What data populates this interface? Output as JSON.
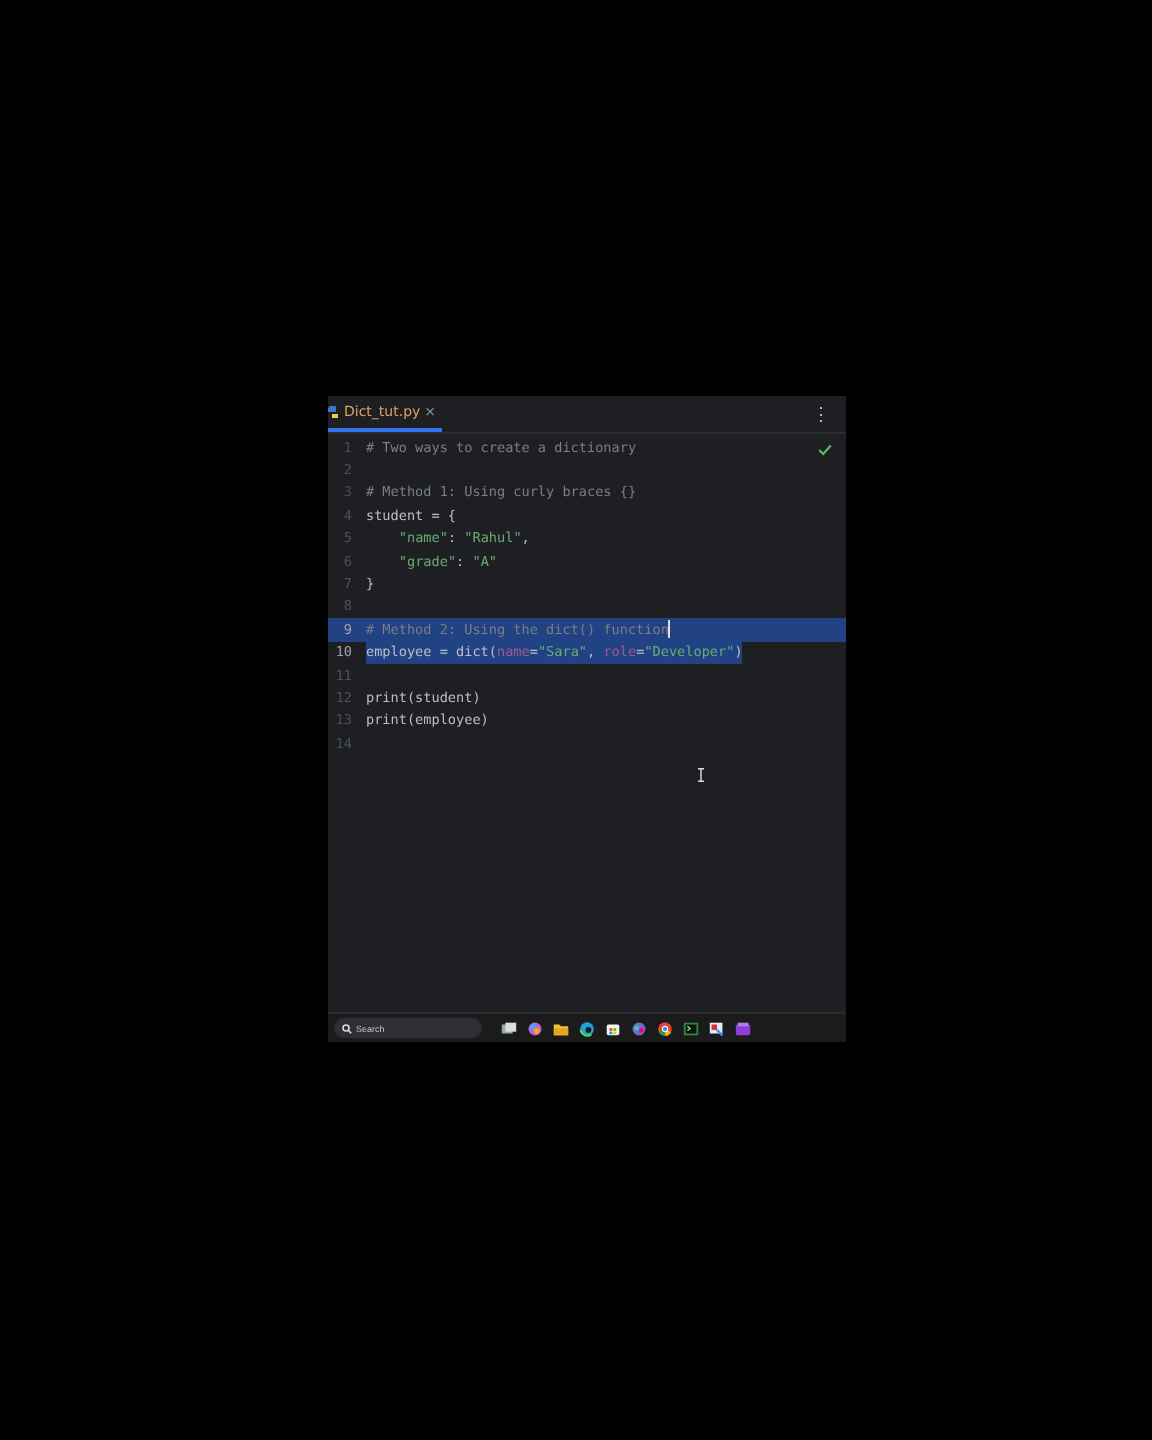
{
  "tab": {
    "label": "Dict_tut.py",
    "close": "×",
    "selected": true
  },
  "menu": "⋮",
  "lines": [
    {
      "number": "1",
      "selected": false,
      "caret": false,
      "tokens": [
        {
          "kind": "comment",
          "text": "# Two ways to create a dictionary"
        }
      ]
    },
    {
      "number": "2",
      "selected": false,
      "caret": false
    },
    {
      "number": "3",
      "selected": false,
      "caret": false,
      "tokens": [
        {
          "kind": "comment",
          "text": "# Method 1: Using curly braces {}"
        }
      ]
    },
    {
      "number": "4",
      "selected": false,
      "caret": false,
      "tokens": [
        {
          "kind": "plain",
          "text": "student = {"
        }
      ]
    },
    {
      "number": "5",
      "selected": false,
      "caret": false,
      "indented": true,
      "tokens": [
        {
          "kind": "string",
          "text": "\"name\""
        },
        {
          "kind": "plain",
          "text": ": "
        },
        {
          "kind": "string",
          "text": "\"Rahul\""
        },
        {
          "kind": "plain",
          "text": ","
        }
      ]
    },
    {
      "number": "6",
      "selected": false,
      "caret": false,
      "indented": true,
      "tokens": [
        {
          "kind": "string",
          "text": "\"grade\""
        },
        {
          "kind": "plain",
          "text": ": "
        },
        {
          "kind": "string",
          "text": "\"A\""
        }
      ]
    },
    {
      "number": "7",
      "selected": false,
      "caret": false,
      "tokens": [
        {
          "kind": "plain",
          "text": "}"
        }
      ]
    },
    {
      "number": "8",
      "selected": false,
      "caret": false
    },
    {
      "number": "9",
      "selected": true,
      "caret": true,
      "tokens": [
        {
          "kind": "comment",
          "text": "# Method 2: Using the dict() function"
        }
      ]
    },
    {
      "number": "10",
      "selected": true,
      "caret": false,
      "tokens": [
        {
          "kind": "plain",
          "text": "employee = dict("
        },
        {
          "kind": "param",
          "text": "name"
        },
        {
          "kind": "plain",
          "text": "="
        },
        {
          "kind": "string",
          "text": "\"Sara\""
        },
        {
          "kind": "plain",
          "text": ", "
        },
        {
          "kind": "param",
          "text": "role"
        },
        {
          "kind": "plain",
          "text": "="
        },
        {
          "kind": "string",
          "text": "\"Developer\""
        },
        {
          "kind": "plain",
          "text": ")"
        }
      ]
    },
    {
      "number": "11",
      "selected": false,
      "caret": false
    },
    {
      "number": "12",
      "selected": false,
      "caret": false,
      "tokens": [
        {
          "kind": "plain",
          "text": "print(student)"
        }
      ]
    },
    {
      "number": "13",
      "selected": false,
      "caret": false,
      "tokens": [
        {
          "kind": "plain",
          "text": "print(employee)"
        }
      ]
    },
    {
      "number": "14",
      "selected": false,
      "caret": false
    }
  ],
  "taskbar": {
    "search": {
      "placeholder": "Search"
    }
  }
}
